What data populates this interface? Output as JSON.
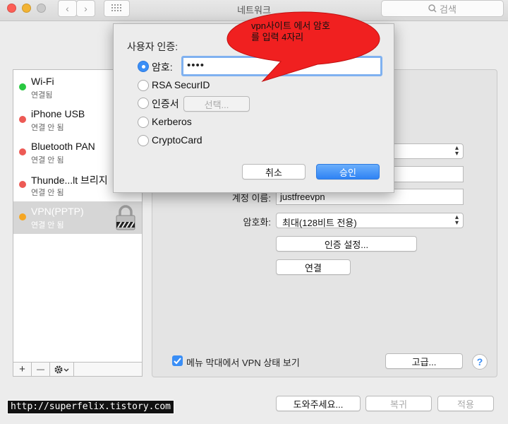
{
  "window": {
    "title": "네트워크"
  },
  "search": {
    "label": "검색"
  },
  "sidebar": {
    "items": [
      {
        "name": "Wi-Fi",
        "status": "연결됨",
        "status_color": "#28c840"
      },
      {
        "name": "iPhone USB",
        "status": "연결 안 됨",
        "status_color": "#ed5a55"
      },
      {
        "name": "Bluetooth PAN",
        "status": "연결 안 됨",
        "status_color": "#ed5a55"
      },
      {
        "name": "Thunde...lt 브리지",
        "status": "연결 안 됨",
        "status_color": "#ed5a55"
      },
      {
        "name": "VPN(PPTP)",
        "status": "연결 안 됨",
        "status_color": "#f5a623",
        "selected": true,
        "icon": "lock-icon"
      }
    ],
    "add_label": "+",
    "remove_label": "—"
  },
  "vpn_panel": {
    "account_label": "계정 이름:",
    "account_value": "justfreevpn",
    "encryption_label": "암호화:",
    "encryption_value": "최대(128비트 전용)",
    "auth_settings_button": "인증 설정...",
    "connect_button": "연결",
    "show_status_label": "메뉴 막대에서 VPN 상태 보기",
    "show_status_checked": true,
    "advanced_button": "고급...",
    "help_button": "?"
  },
  "footer": {
    "assist_button": "도와주세요...",
    "revert_button": "복귀",
    "apply_button": "적용"
  },
  "auth_dialog": {
    "title": "사용자 인증:",
    "options": [
      {
        "label": "암호:",
        "selected": true
      },
      {
        "label": "RSA SecurID",
        "selected": false
      },
      {
        "label": "인증서",
        "selected": false
      },
      {
        "label": "Kerberos",
        "selected": false
      },
      {
        "label": "CryptoCard",
        "selected": false
      }
    ],
    "password_value": "••••",
    "select_button": "선택...",
    "cancel_button": "취소",
    "ok_button": "승인"
  },
  "annotation": {
    "line1": "vpn사이트 에서 암호",
    "line2": "를 입력 4자리"
  },
  "watermark": "http://superfelix.tistory.com"
}
